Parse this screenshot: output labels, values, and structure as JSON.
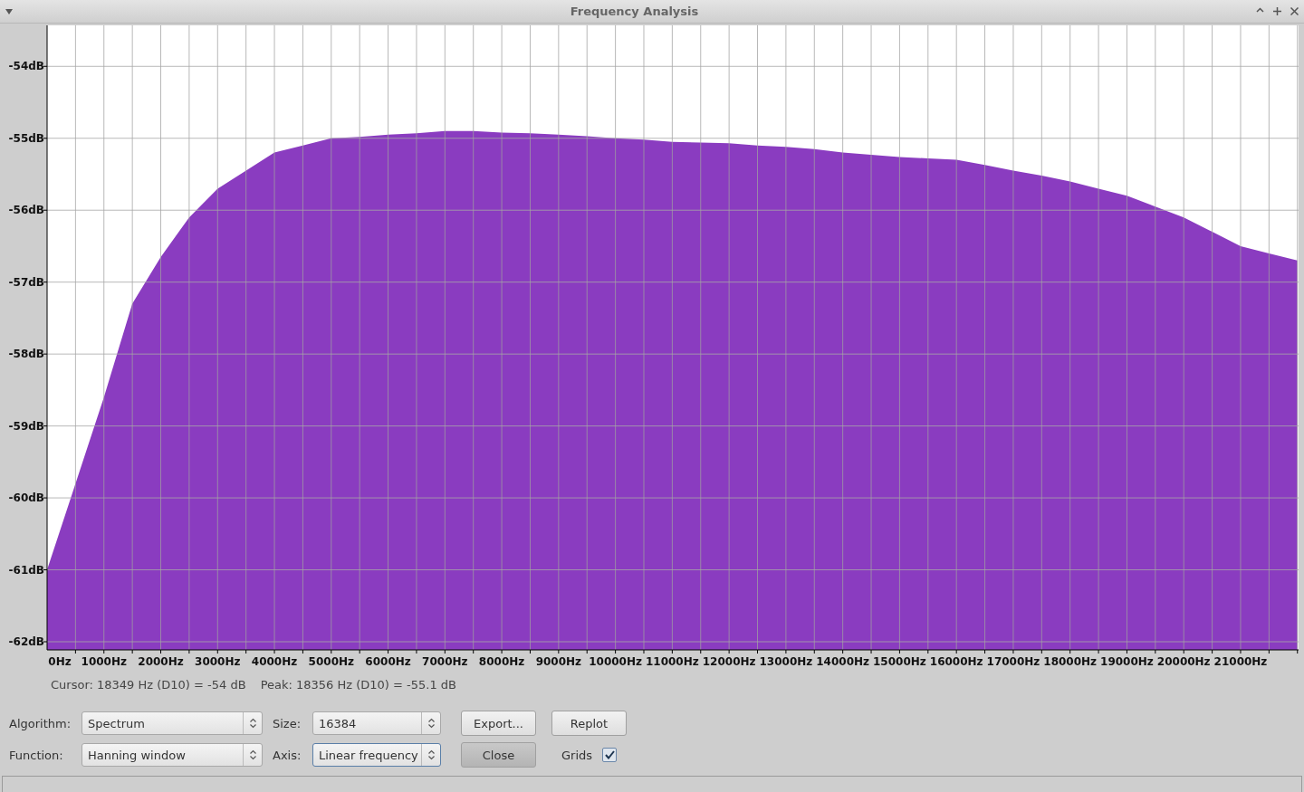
{
  "window": {
    "title": "Frequency Analysis"
  },
  "chart": {
    "chart_data": {
      "type": "area",
      "grid": true,
      "x": [
        0,
        500,
        1000,
        1500,
        2000,
        2500,
        3000,
        3500,
        4000,
        4500,
        5000,
        5500,
        6000,
        6500,
        7000,
        7500,
        8000,
        8500,
        9000,
        9500,
        10000,
        10500,
        11000,
        11500,
        12000,
        12500,
        13000,
        13500,
        14000,
        14500,
        15000,
        15500,
        16000,
        16500,
        17000,
        17500,
        18000,
        18500,
        19000,
        19500,
        20000,
        20500,
        21000,
        21500,
        22000
      ],
      "series": [
        {
          "color": "#8a3cc0",
          "values": [
            -61.0,
            -59.8,
            -58.6,
            -57.3,
            -56.65,
            -56.1,
            -55.7,
            -55.45,
            -55.2,
            -55.1,
            -55.0,
            -54.98,
            -54.95,
            -54.93,
            -54.9,
            -54.9,
            -54.92,
            -54.93,
            -54.95,
            -54.97,
            -55.0,
            -55.02,
            -55.05,
            -55.06,
            -55.07,
            -55.1,
            -55.12,
            -55.15,
            -55.2,
            -55.23,
            -55.26,
            -55.28,
            -55.3,
            -55.37,
            -55.45,
            -55.52,
            -55.6,
            -55.7,
            -55.8,
            -55.95,
            -56.1,
            -56.3,
            -56.5,
            -56.6,
            -56.7
          ]
        }
      ],
      "xlim": [
        0,
        22020
      ],
      "ylim": [
        -62,
        -53.43
      ],
      "xticks": [
        {
          "value": 0,
          "label": "0Hz"
        },
        {
          "value": 1000,
          "label": "1000Hz"
        },
        {
          "value": 2000,
          "label": "2000Hz"
        },
        {
          "value": 3000,
          "label": "3000Hz"
        },
        {
          "value": 4000,
          "label": "4000Hz"
        },
        {
          "value": 5000,
          "label": "5000Hz"
        },
        {
          "value": 6000,
          "label": "6000Hz"
        },
        {
          "value": 7000,
          "label": "7000Hz"
        },
        {
          "value": 8000,
          "label": "8000Hz"
        },
        {
          "value": 9000,
          "label": "9000Hz"
        },
        {
          "value": 10000,
          "label": "10000Hz"
        },
        {
          "value": 11000,
          "label": "11000Hz"
        },
        {
          "value": 12000,
          "label": "12000Hz"
        },
        {
          "value": 13000,
          "label": "13000Hz"
        },
        {
          "value": 14000,
          "label": "14000Hz"
        },
        {
          "value": 15000,
          "label": "15000Hz"
        },
        {
          "value": 16000,
          "label": "16000Hz"
        },
        {
          "value": 17000,
          "label": "17000Hz"
        },
        {
          "value": 18000,
          "label": "18000Hz"
        },
        {
          "value": 19000,
          "label": "19000Hz"
        },
        {
          "value": 20000,
          "label": "20000Hz"
        },
        {
          "value": 21000,
          "label": "21000Hz"
        }
      ],
      "yticks": [
        {
          "value": -54,
          "label": "-54dB"
        },
        {
          "value": -55,
          "label": "-55dB"
        },
        {
          "value": -56,
          "label": "-56dB"
        },
        {
          "value": -57,
          "label": "-57dB"
        },
        {
          "value": -58,
          "label": "-58dB"
        },
        {
          "value": -59,
          "label": "-59dB"
        },
        {
          "value": -60,
          "label": "-60dB"
        },
        {
          "value": -61,
          "label": "-61dB"
        },
        {
          "value": -62,
          "label": "-62dB"
        }
      ]
    }
  },
  "readout": {
    "cursor": "Cursor: 18349 Hz (D10) = -54 dB",
    "peak": "Peak: 18356 Hz (D10) = -55.1 dB"
  },
  "controls": {
    "algorithm": {
      "label": "Algorithm:",
      "value": "Spectrum",
      "focused": false
    },
    "size": {
      "label": "Size:",
      "value": "16384",
      "focused": false
    },
    "function": {
      "label": "Function:",
      "value": "Hanning window",
      "focused": false
    },
    "axis": {
      "label": "Axis:",
      "value": "Linear frequency",
      "focused": true
    },
    "buttons": [
      {
        "label": "Export...",
        "default": false
      },
      {
        "label": "Replot",
        "default": false
      },
      {
        "label": "Close",
        "default": true
      }
    ],
    "grids": {
      "label": "Grids",
      "checked": true
    }
  }
}
